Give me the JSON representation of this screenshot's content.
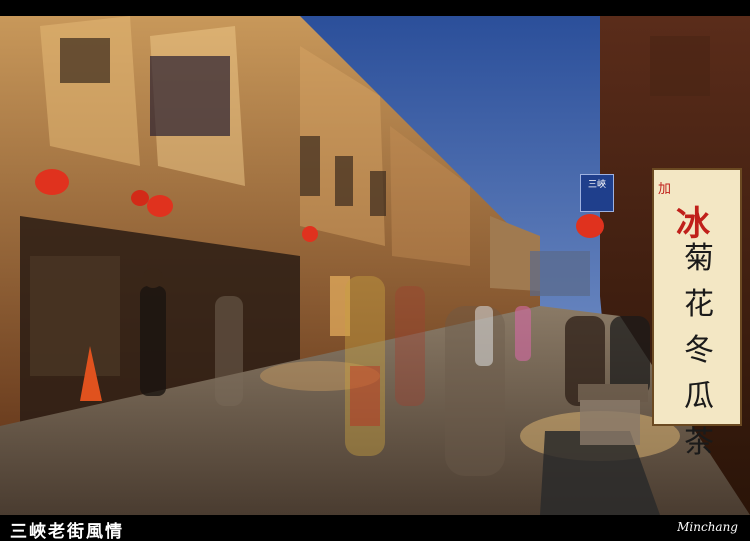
{
  "caption": {
    "title": "三峽老街風情",
    "signature": "Minchang"
  },
  "shop_sign": {
    "small": "加",
    "big": "冰",
    "column": "菊花冬瓜茶"
  },
  "blue_sign": {
    "text": "三峽"
  },
  "colors": {
    "sky_top": "#2b4f9a",
    "sky_bottom": "#8aa4d4",
    "building_warm": "#b8864a",
    "street": "#6a5a4a",
    "lantern": "#e0321e"
  }
}
